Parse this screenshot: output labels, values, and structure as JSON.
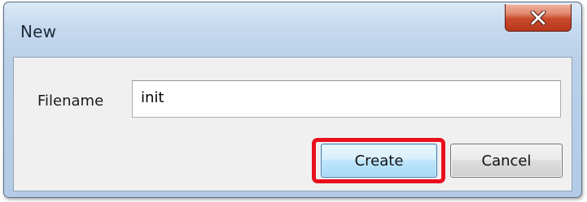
{
  "dialog": {
    "title": "New",
    "close_icon": "close-icon"
  },
  "form": {
    "filename_label": "Filename",
    "filename_value": "init"
  },
  "buttons": {
    "create_label": "Create",
    "cancel_label": "Cancel"
  },
  "colors": {
    "highlight": "#e8101e",
    "close_button": "#c94a2c"
  }
}
